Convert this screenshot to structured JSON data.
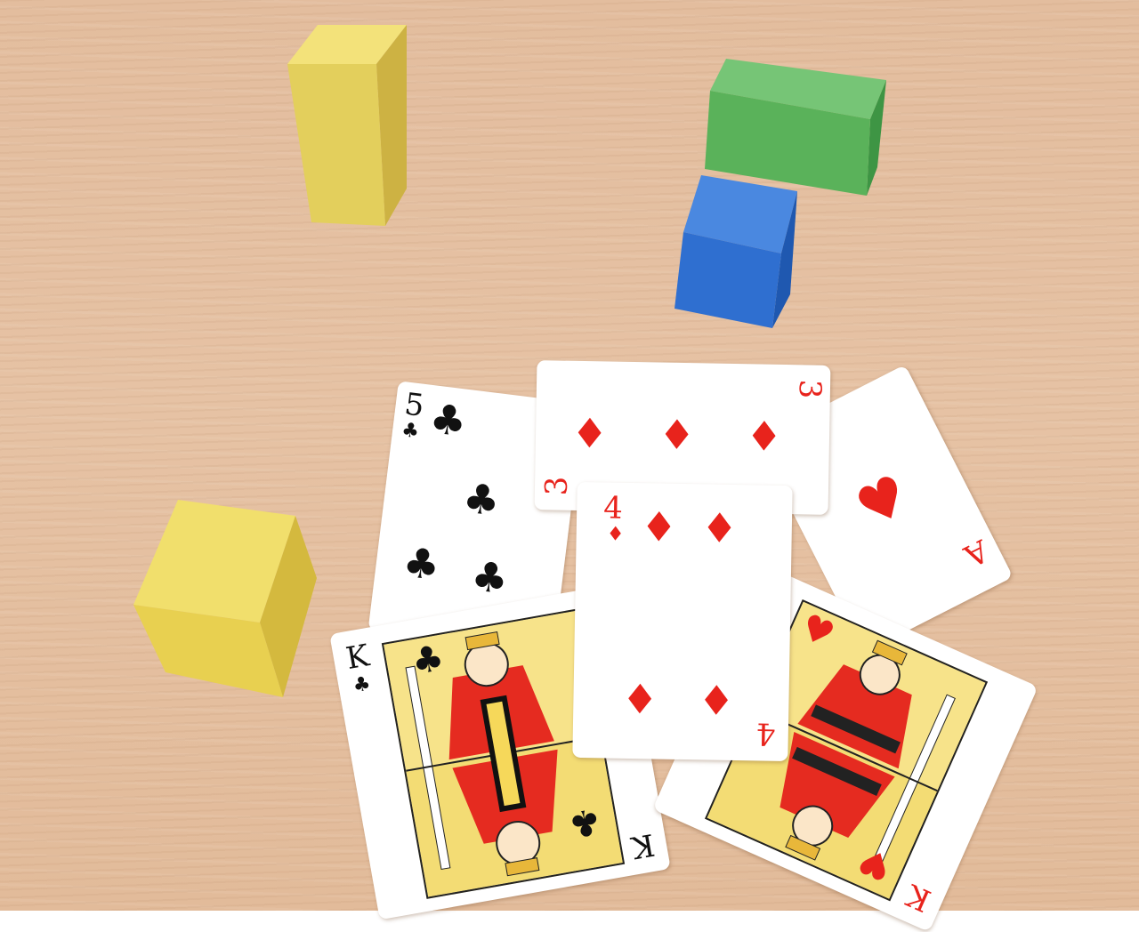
{
  "scene": {
    "table_color": "#e4bf9f",
    "blocks": [
      {
        "name": "tall-yellow-block",
        "color": "#e3cf5c"
      },
      {
        "name": "green-block",
        "color": "#5ab25a"
      },
      {
        "name": "blue-block",
        "color": "#2f6fd0"
      },
      {
        "name": "yellow-cube-block",
        "color": "#e8d050"
      }
    ],
    "cards": [
      {
        "name": "five-of-clubs",
        "rank": "5",
        "suit": "♣",
        "color": "#111111"
      },
      {
        "name": "three-of-diamonds",
        "rank": "3",
        "suit": "♦",
        "color": "#e8231c"
      },
      {
        "name": "ace-of-hearts",
        "rank": "A",
        "suit": "♥",
        "color": "#e8231c"
      },
      {
        "name": "four-of-diamonds",
        "rank": "4",
        "suit": "♦",
        "color": "#e8231c"
      },
      {
        "name": "king-of-clubs",
        "rank": "K",
        "suit": "♣",
        "color": "#111111"
      },
      {
        "name": "king-of-hearts",
        "rank": "K",
        "suit": "♥",
        "color": "#e8231c"
      }
    ]
  }
}
